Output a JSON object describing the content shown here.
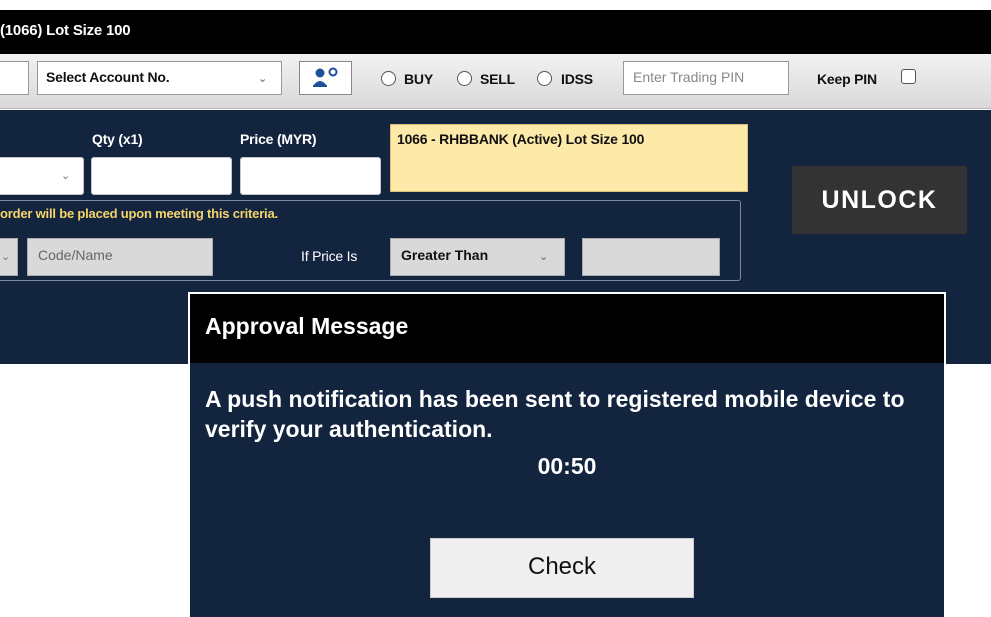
{
  "title_bar": {
    "text": "(1066)  Lot Size 100"
  },
  "toolbar": {
    "account_select": "Select Account No.",
    "buy_label": "BUY",
    "sell_label": "SELL",
    "idss_label": "IDSS",
    "trading_pin_placeholder": "Enter Trading PIN",
    "keep_pin_label": "Keep PIN",
    "user_icon": "user-badge-icon"
  },
  "order": {
    "qty_label": "Qty (x1)",
    "price_label": "Price (MYR)",
    "qty_value": "",
    "price_value": "",
    "stock_info": "1066 - RHBBANK (Active) Lot Size 100",
    "unlock_label": "UNLOCK",
    "criteria_note": "order will be placed upon meeting this criteria.",
    "code_placeholder": "Code/Name",
    "if_price_label": "If Price Is",
    "condition_select": "Greater Than",
    "condition_value": ""
  },
  "modal": {
    "title": "Approval Message",
    "message": "A push notification has been sent to registered mobile device to verify your authentication.",
    "timer": "00:50",
    "check_label": "Check"
  },
  "colors": {
    "panel_bg": "#13243f",
    "stock_info_bg": "#fde9a8",
    "criteria_text": "#f5d46b"
  }
}
